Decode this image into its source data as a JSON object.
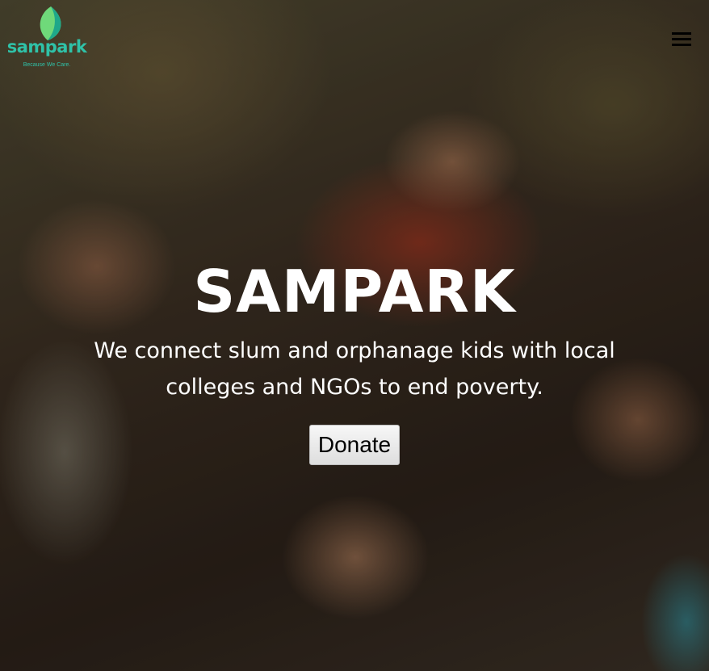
{
  "logo": {
    "icon": "leaf-icon",
    "wordmark": "sampark",
    "tagline": "Because We Care.",
    "brand_color": "#2fc2a8",
    "leaf_light": "#6fd97a",
    "leaf_dark": "#1fa88a"
  },
  "nav": {
    "menu_icon": "hamburger-menu-icon"
  },
  "hero": {
    "title": "SAMPARK",
    "subtitle": "We connect slum and orphanage kids with local colleges and NGOs to end poverty.",
    "donate_label": "Donate",
    "background": "photo of children looking up"
  }
}
